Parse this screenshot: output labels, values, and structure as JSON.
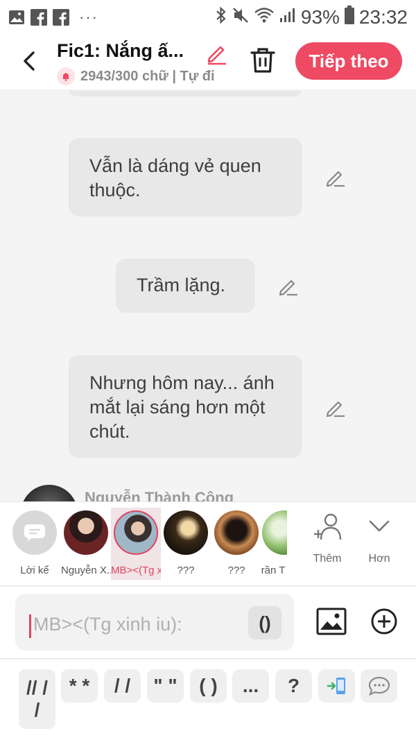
{
  "status_bar": {
    "battery": "93%",
    "time": "23:32"
  },
  "header": {
    "title": "Fic1: Nắng ấ...",
    "subtitle": "2943/300 chữ | Tự đi",
    "next_label": "Tiếp theo"
  },
  "messages": [
    {
      "text": "Vẫn là dáng vẻ quen thuộc."
    },
    {
      "text": "Trầm lặng."
    },
    {
      "text": "Nhưng hôm nay... ánh mắt lại sáng hơn một chút."
    }
  ],
  "author_peek": {
    "name": "Nguyễn Thành Công"
  },
  "characters": [
    {
      "label": "Lời kể"
    },
    {
      "label": "Nguyễn X..."
    },
    {
      "label": "MB><(Tg x..."
    },
    {
      "label": "???"
    },
    {
      "label": "???"
    },
    {
      "label": "rần T"
    }
  ],
  "tools": {
    "add_label": "Thêm",
    "more_label": "Hơn"
  },
  "input": {
    "placeholder": "MB><(Tg xinh iu):",
    "paren_label": "()"
  },
  "quick_keys": [
    "// /\n/",
    "* *",
    "/ /",
    "\" \"",
    "( )",
    "...",
    "?"
  ],
  "colors": {
    "accent": "#ee4a63",
    "bubble": "#e8e8e8",
    "background": "#f4f4f4"
  }
}
